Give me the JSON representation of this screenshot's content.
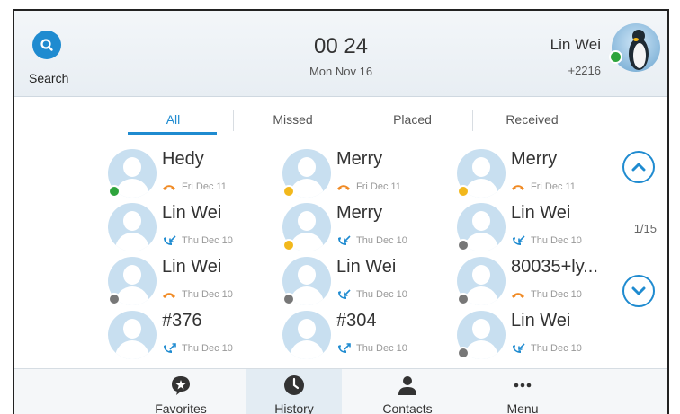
{
  "header": {
    "search_label": "Search",
    "time": "00 24",
    "date": "Mon Nov 16",
    "account_name": "Lin Wei",
    "account_ext": "+2216"
  },
  "tabs": [
    "All",
    "Missed",
    "Placed",
    "Received"
  ],
  "history": [
    {
      "name": "Hedy",
      "date": "Fri Dec 11",
      "call_type": "missed",
      "status": "green"
    },
    {
      "name": "Merry",
      "date": "Fri Dec 11",
      "call_type": "missed",
      "status": "yellow"
    },
    {
      "name": "Merry",
      "date": "Fri Dec 11",
      "call_type": "missed",
      "status": "yellow"
    },
    {
      "name": "Lin Wei",
      "date": "Thu Dec 10",
      "call_type": "received",
      "status": "none"
    },
    {
      "name": "Merry",
      "date": "Thu Dec 10",
      "call_type": "received",
      "status": "yellow"
    },
    {
      "name": "Lin Wei",
      "date": "Thu Dec 10",
      "call_type": "received",
      "status": "gray"
    },
    {
      "name": "Lin Wei",
      "date": "Thu Dec 10",
      "call_type": "missed",
      "status": "gray"
    },
    {
      "name": "Lin Wei",
      "date": "Thu Dec 10",
      "call_type": "received",
      "status": "gray"
    },
    {
      "name": "80035+ly...",
      "date": "Thu Dec 10",
      "call_type": "missed",
      "status": "gray"
    },
    {
      "name": "#376",
      "date": "Thu Dec 10",
      "call_type": "placed",
      "status": "none"
    },
    {
      "name": "#304",
      "date": "Thu Dec 10",
      "call_type": "placed",
      "status": "none"
    },
    {
      "name": "Lin Wei",
      "date": "Thu Dec 10",
      "call_type": "received",
      "status": "gray"
    }
  ],
  "pagination": "1/15",
  "bottom_nav": [
    "Favorites",
    "History",
    "Contacts",
    "Menu"
  ],
  "colors": {
    "accent": "#1f8bd0",
    "missed": "#f08a24",
    "presence_online": "#2ea43c",
    "presence_busy": "#f2b81c"
  }
}
